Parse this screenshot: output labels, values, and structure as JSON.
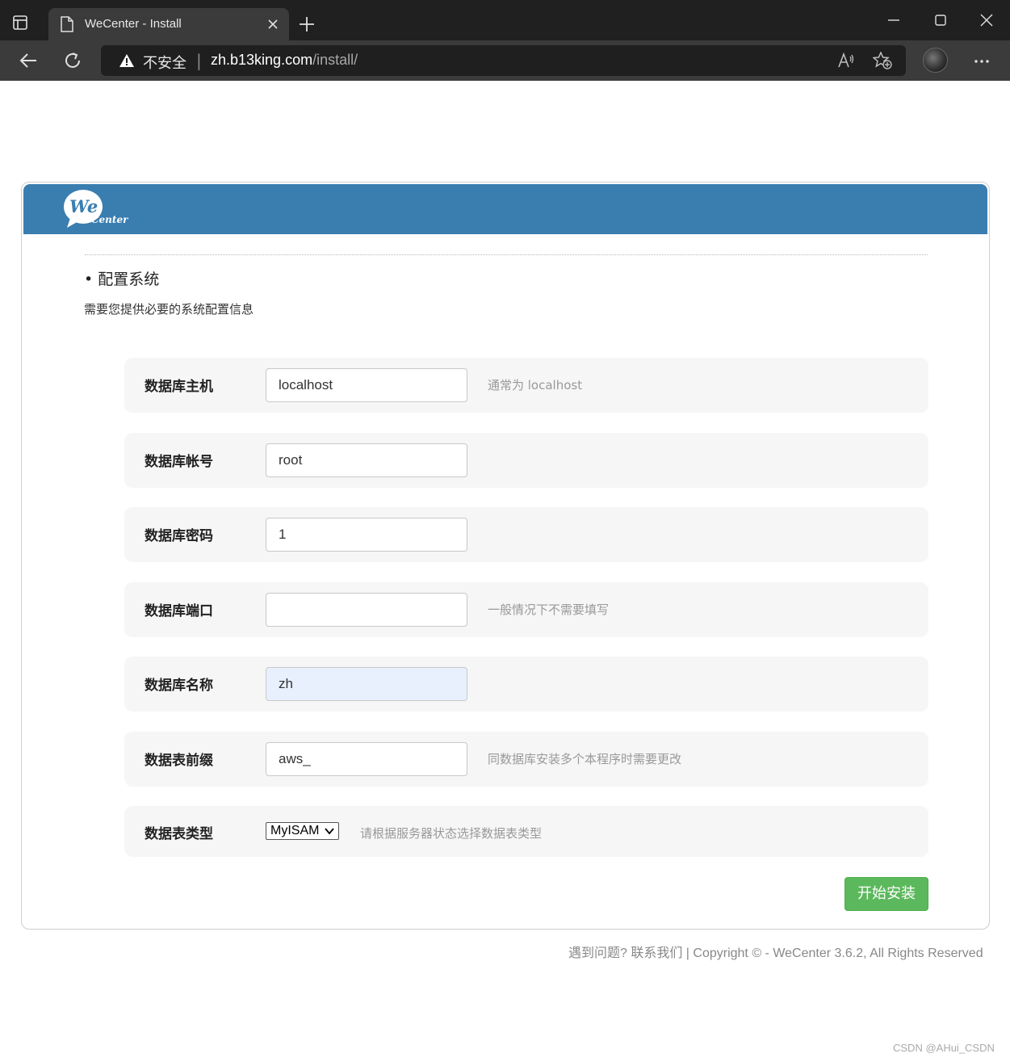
{
  "browser": {
    "tab_title": "WeCenter - Install",
    "security_label": "不安全",
    "url_host": "zh.b13king.com",
    "url_path": "/install/"
  },
  "page": {
    "logo_we": "We",
    "logo_center": "Center",
    "section_title": "• 配置系统",
    "section_desc": "需要您提供必要的系统配置信息",
    "fields": [
      {
        "label": "数据库主机",
        "value": "localhost",
        "hint": "通常为 localhost"
      },
      {
        "label": "数据库帐号",
        "value": "root",
        "hint": ""
      },
      {
        "label": "数据库密码",
        "value": "1",
        "hint": ""
      },
      {
        "label": "数据库端口",
        "value": "",
        "hint": "一般情况下不需要填写"
      },
      {
        "label": "数据库名称",
        "value": "zh",
        "hint": ""
      },
      {
        "label": "数据表前缀",
        "value": "aws_",
        "hint": "同数据库安装多个本程序时需要更改"
      }
    ],
    "table_type": {
      "label": "数据表类型",
      "selected": "MyISAM",
      "hint": "请根据服务器状态选择数据表类型"
    },
    "install_button": "开始安装",
    "footer": "遇到问题? 联系我们 | Copyright © - WeCenter 3.6.2, All Rights Reserved"
  },
  "watermark": "CSDN @AHui_CSDN",
  "colors": {
    "header_blue": "#3a7eb0",
    "install_green": "#5cb85c",
    "autofill": "#e8f0fe"
  }
}
